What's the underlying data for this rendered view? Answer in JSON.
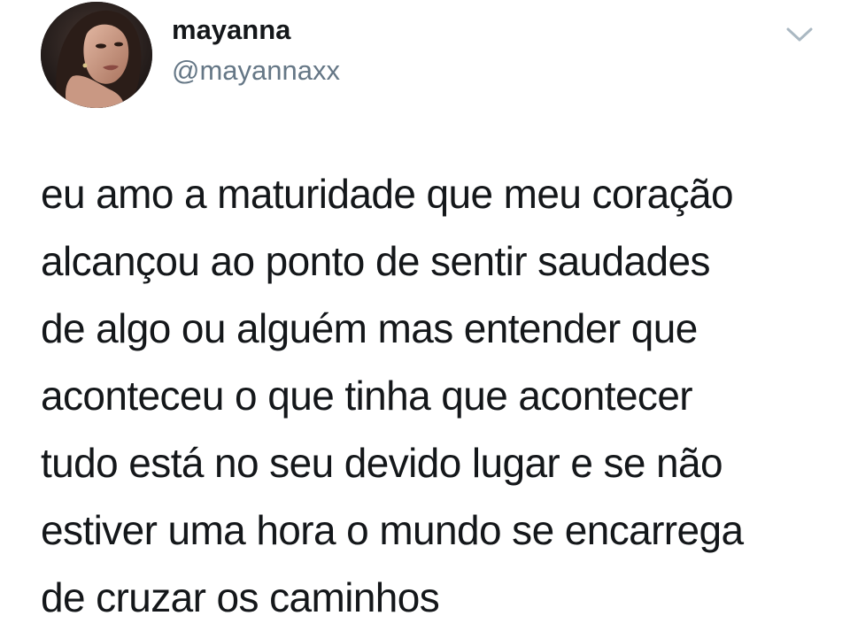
{
  "tweet": {
    "author": {
      "display_name": "mayanna",
      "handle": "@mayannaxx",
      "avatar_icon": "profile-photo"
    },
    "menu_icon": "chevron-down-icon",
    "text_lines": [
      "eu amo a maturidade que meu coração",
      "alcançou ao ponto de sentir saudades",
      "de algo ou alguém mas entender que",
      "aconteceu o que tinha que acontecer",
      "tudo está no seu devido lugar e se não",
      "estiver uma hora o mundo se encarrega",
      "de cruzar os caminhos"
    ]
  },
  "colors": {
    "text": "#14171a",
    "secondary": "#657786",
    "chevron": "#aab8c2",
    "background": "#ffffff"
  }
}
